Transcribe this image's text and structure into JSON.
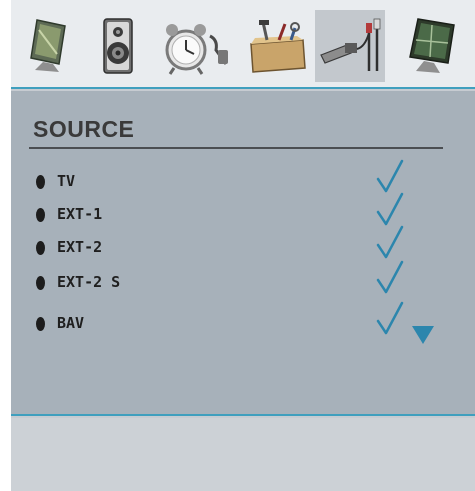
{
  "colors": {
    "accent": "#3f9fbe",
    "panel": "#a7b1ba",
    "check": "#2c86ad"
  },
  "tabs": [
    {
      "icon": "tv-picture-icon",
      "selected": false
    },
    {
      "icon": "speaker-sound-icon",
      "selected": false
    },
    {
      "icon": "alarm-clock-icon",
      "selected": false
    },
    {
      "icon": "toolbox-setup-icon",
      "selected": false
    },
    {
      "icon": "cable-source-icon",
      "selected": true
    },
    {
      "icon": "tv-feature-icon",
      "selected": false
    }
  ],
  "menu": {
    "title": "SOURCE",
    "items": [
      {
        "label": "TV",
        "enabled": true
      },
      {
        "label": "EXT-1",
        "enabled": true
      },
      {
        "label": "EXT-2",
        "enabled": true
      },
      {
        "label": "EXT-2 S",
        "enabled": true
      },
      {
        "label": "BAV",
        "enabled": true
      }
    ]
  }
}
